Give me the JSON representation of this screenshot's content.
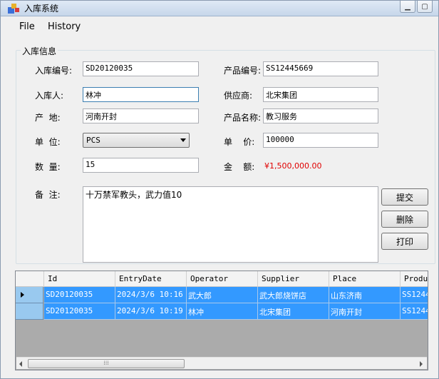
{
  "window": {
    "title": "入库系统",
    "background_tabs": [
      "",
      "",
      ""
    ]
  },
  "menu": {
    "file": "File",
    "history": "History"
  },
  "form": {
    "group_title": "入库信息",
    "labels": {
      "entry_no": "入库编号:",
      "product_no": "产品编号:",
      "operator": "入库人:",
      "supplier": "供应商:",
      "origin": "产  地:",
      "product_name": "产品名称:",
      "unit": "单  位:",
      "unit_price": "单    价:",
      "quantity": "数  量:",
      "amount": "金    额:",
      "remarks": "备  注:"
    },
    "values": {
      "entry_no": "SD20120035",
      "product_no": "SS12445669",
      "operator": "林冲",
      "supplier": "北宋集团",
      "origin": "河南开封",
      "product_name": "教习服务",
      "unit": "PCS",
      "unit_price": "100000",
      "quantity": "15",
      "amount": "¥1,500,000.00",
      "remarks": "十万禁军教头，武力值10"
    }
  },
  "buttons": {
    "submit": "提交",
    "delete": "删除",
    "print": "打印"
  },
  "grid": {
    "columns": [
      "Id",
      "EntryDate",
      "Operator",
      "Supplier",
      "Place",
      "Produ"
    ],
    "rows": [
      [
        "SD20120035",
        "2024/3/6 10:16",
        "武大郎",
        "武大郎烧饼店",
        "山东济南",
        "SS1244"
      ],
      [
        "SD20120035",
        "2024/3/6 10:19",
        "林冲",
        "北宋集团",
        "河南开封",
        "SS1244"
      ]
    ]
  },
  "colors": {
    "selection": "#3399ff",
    "amount_text": "#e00000",
    "grid_background": "#ababab"
  },
  "icons": {
    "app": "app-window-icon",
    "minimize": "minimize-icon",
    "maximize": "maximize-icon",
    "row_indicator": "current-row-arrow-icon"
  }
}
